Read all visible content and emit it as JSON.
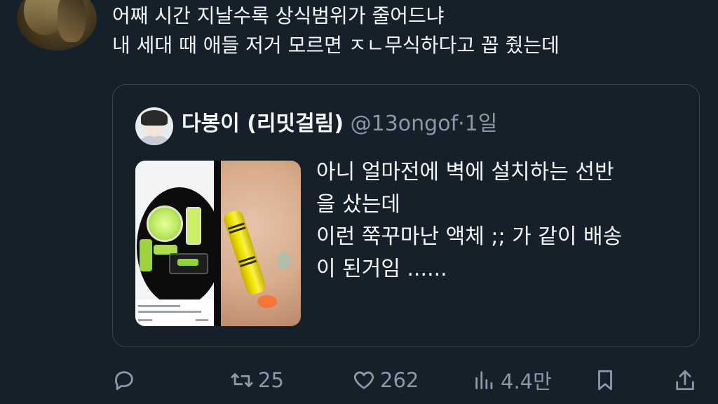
{
  "tweet": {
    "lines": [
      "어째 시간 지날수록 상식범위가 줄어드냐",
      "내 세대 때 애들 저거 모르면 ㅈㄴ무식하다고 꼽 줬는데"
    ]
  },
  "quote": {
    "display_name": "다봉이 (리밋걸림)",
    "handle": "@13ongof",
    "separator": "·",
    "time": "1일",
    "text_lines": [
      "아니 얼마전에 벽에 설치하는 선반",
      "을 샀는데",
      "이런 쭉꾸마난 액체 ;; 가 같이 배송",
      "이 된거임 ......"
    ]
  },
  "actions": {
    "reply": {
      "icon": "reply-icon",
      "count": ""
    },
    "retweet": {
      "icon": "retweet-icon",
      "count": "25"
    },
    "like": {
      "icon": "heart-icon",
      "count": "262"
    },
    "views": {
      "icon": "views-icon",
      "count": "4.4만"
    },
    "bookmark": {
      "icon": "bookmark-icon"
    },
    "share": {
      "icon": "share-icon"
    }
  },
  "colors": {
    "background": "#15202b",
    "text": "#f7f9f9",
    "secondary_text": "#8b98a5",
    "border": "#38444d"
  }
}
